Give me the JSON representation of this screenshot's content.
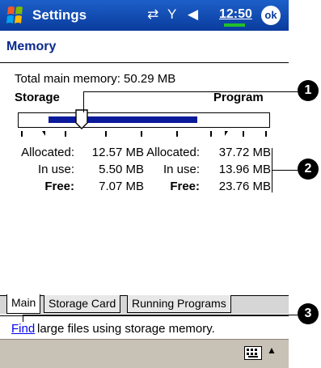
{
  "titlebar": {
    "title": "Settings",
    "time": "12:50",
    "ok_label": "ok",
    "icons": [
      "windows-start-icon",
      "connectivity-icon",
      "signal-icon",
      "speaker-icon",
      "battery-icon"
    ]
  },
  "header": {
    "title": "Memory"
  },
  "memory": {
    "total": "Total main memory:  50.29 MB",
    "storage_label": "Storage",
    "program_label": "Program",
    "slider_position_percent": 25,
    "storage": [
      {
        "label": "Allocated:",
        "value": "12.57 MB"
      },
      {
        "label": "In use:",
        "value": "5.50 MB"
      },
      {
        "label": "Free:",
        "value": "7.07 MB"
      }
    ],
    "program": [
      {
        "label": "Allocated:",
        "value": "37.72 MB"
      },
      {
        "label": "In use:",
        "value": "13.96 MB"
      },
      {
        "label": "Free:",
        "value": "23.76 MB"
      }
    ]
  },
  "tabs": [
    {
      "label": "Main",
      "active": true
    },
    {
      "label": "Storage Card",
      "active": false
    },
    {
      "label": "Running Programs",
      "active": false
    }
  ],
  "findbar": {
    "link": "Find",
    "text": "large files using storage memory."
  },
  "callouts": [
    "1",
    "2",
    "3"
  ],
  "colors": {
    "titlebar": "#0a3c9d",
    "accent_text": "#0a2a8a",
    "slider_fill": "#0a1a9a",
    "link": "#0000ee",
    "cmdbar": "#c7c1b6"
  }
}
